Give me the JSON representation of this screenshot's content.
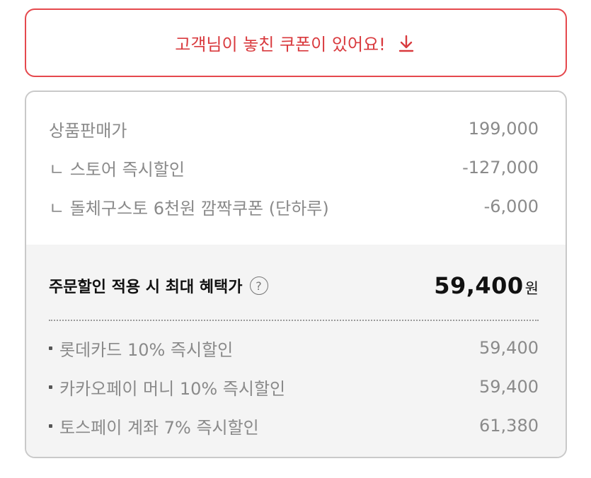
{
  "coupon_banner": {
    "text": "고객님이 놓친 쿠폰이 있어요!",
    "icon": "download-arrow-icon",
    "color": "#d93a3e"
  },
  "price_breakdown": {
    "rows": [
      {
        "label": "상품판매가",
        "value": "199,000"
      },
      {
        "label": "ㄴ 스토어 즉시할인",
        "value": "-127,000"
      },
      {
        "label": "ㄴ 돌체구스토 6천원 깜짝쿠폰 (단하루)",
        "value": "-6,000"
      }
    ]
  },
  "max_benefit": {
    "label": "주문할인 적용 시 최대 혜택가",
    "help_icon": "question-circle-icon",
    "help_glyph": "?",
    "price": "59,400",
    "unit": "원"
  },
  "card_discounts": [
    {
      "label": "롯데카드 10% 즉시할인",
      "value": "59,400"
    },
    {
      "label": "카카오페이 머니 10% 즉시할인",
      "value": "59,400"
    },
    {
      "label": "토스페이 계좌 7% 즉시할인",
      "value": "61,380"
    }
  ]
}
